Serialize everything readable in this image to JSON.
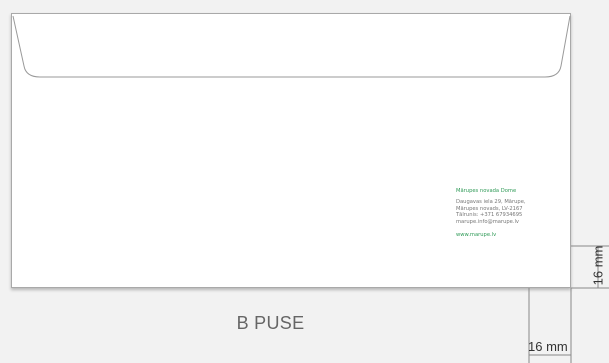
{
  "sender": {
    "org": "Mārupes novada Dome",
    "address_line1": "Daugavas iela 29, Mārupe,",
    "address_line2": "Mārupes novads, LV-2167",
    "phone": "Tālrunis: +371 67934695",
    "email": "marupe.info@marupe.lv",
    "website": "www.marupe.lv"
  },
  "side_label": "B PUSE",
  "dimensions": {
    "right_margin": "16 mm",
    "bottom_margin": "16 mm"
  },
  "colors": {
    "accent_green": "#2f9a57",
    "background": "#f2f2f2",
    "envelope": "#ffffff"
  }
}
